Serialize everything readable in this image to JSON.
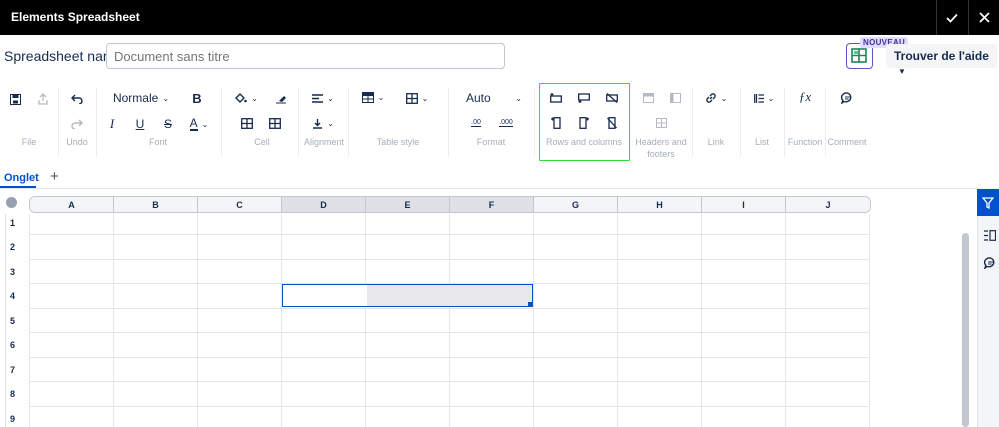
{
  "window": {
    "title": "Elements Spreadsheet"
  },
  "header": {
    "name_label": "Spreadsheet name",
    "name_placeholder": "Document sans titre",
    "badge": "NOUVEAU",
    "help_label": "Trouver de l'aide"
  },
  "toolbar": {
    "font_style": "Normale",
    "format_value": "Auto",
    "format_dec_decrease": ".00",
    "format_dec_increase": ".000",
    "groups": {
      "file": "File",
      "undo": "Undo",
      "font": "Font",
      "cell": "Cell",
      "alignment": "Alignment",
      "table_style": "Table style",
      "format": "Format",
      "rows_columns": "Rows and columns",
      "headers_footers": "Headers and footers",
      "link": "Link",
      "list": "List",
      "function": "Function",
      "comment": "Comment"
    }
  },
  "sheet_tabs": [
    {
      "label": "Onglet",
      "active": true
    }
  ],
  "grid": {
    "columns": [
      "A",
      "B",
      "C",
      "D",
      "E",
      "F",
      "G",
      "H",
      "I",
      "J"
    ],
    "rows": [
      "1",
      "2",
      "3",
      "4",
      "5",
      "6",
      "7",
      "8",
      "9"
    ],
    "selection": "D4:F4"
  },
  "colors": {
    "accent": "#0052cc",
    "highlight": "#36d636",
    "titlebar": "#000000"
  }
}
